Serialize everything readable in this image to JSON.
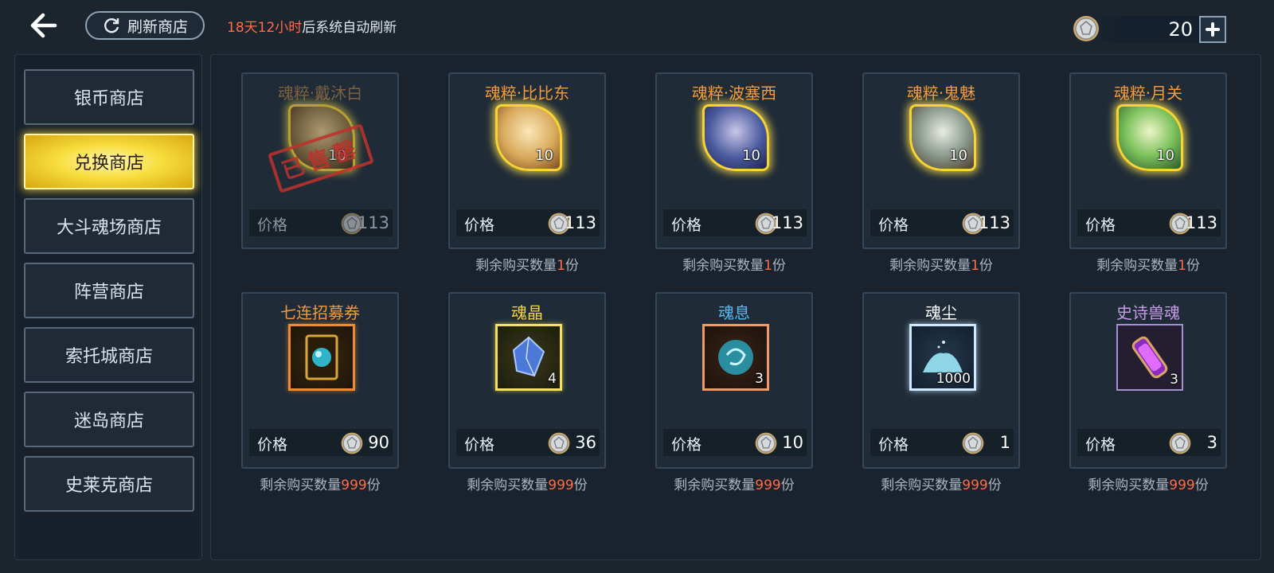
{
  "header": {
    "refresh_button_label": "刷新商店",
    "refresh_timer": "18天12小时",
    "refresh_note": "后系统自动刷新",
    "currency_amount": "20",
    "back_icon": "back-arrow-icon",
    "refresh_icon": "refresh-icon",
    "coin_icon": "silver-coin-icon",
    "plus_icon": "plus-icon"
  },
  "sidebar": {
    "tabs": [
      {
        "label": "银币商店",
        "active": false
      },
      {
        "label": "兑换商店",
        "active": true
      },
      {
        "label": "大斗魂场商店",
        "active": false
      },
      {
        "label": "阵营商店",
        "active": false
      },
      {
        "label": "索托城商店",
        "active": false
      },
      {
        "label": "迷岛商店",
        "active": false
      },
      {
        "label": "史莱克商店",
        "active": false
      }
    ]
  },
  "shop": {
    "price_label": "价格",
    "remaining_prefix": "剩余购买数量",
    "remaining_suffix": "份",
    "sold_out_stamp": "已售罄",
    "items": [
      {
        "name": "魂粹·戴沐白",
        "qty": "10",
        "price": "113",
        "remaining": "",
        "sold_out": true,
        "title_color": "#e8a14b"
      },
      {
        "name": "魂粹·比比东",
        "qty": "10",
        "price": "113",
        "remaining": "1",
        "sold_out": false,
        "title_color": "#f29a3c"
      },
      {
        "name": "魂粹·波塞西",
        "qty": "10",
        "price": "113",
        "remaining": "1",
        "sold_out": false,
        "title_color": "#f29a3c"
      },
      {
        "name": "魂粹·鬼魅",
        "qty": "10",
        "price": "113",
        "remaining": "1",
        "sold_out": false,
        "title_color": "#f29a3c"
      },
      {
        "name": "魂粹·月关",
        "qty": "10",
        "price": "113",
        "remaining": "1",
        "sold_out": false,
        "title_color": "#f29a3c"
      },
      {
        "name": "七连招募券",
        "qty": "",
        "price": "90",
        "remaining": "999",
        "sold_out": false,
        "title_color": "#f29a3c",
        "frame_color": "#f08a2a"
      },
      {
        "name": "魂晶",
        "qty": "4",
        "price": "36",
        "remaining": "999",
        "sold_out": false,
        "title_color": "#f3d34a",
        "frame_color": "#f3e25a"
      },
      {
        "name": "魂息",
        "qty": "3",
        "price": "10",
        "remaining": "999",
        "sold_out": false,
        "title_color": "#5fb7f0",
        "frame_color": "#f09a6a"
      },
      {
        "name": "魂尘",
        "qty": "1000",
        "price": "1",
        "remaining": "999",
        "sold_out": false,
        "title_color": "#ffffff",
        "frame_color": "#cfeaff"
      },
      {
        "name": "史诗兽魂",
        "qty": "3",
        "price": "3",
        "remaining": "999",
        "sold_out": false,
        "title_color": "#c79ae8",
        "frame_color": "#a58fd0"
      }
    ]
  }
}
